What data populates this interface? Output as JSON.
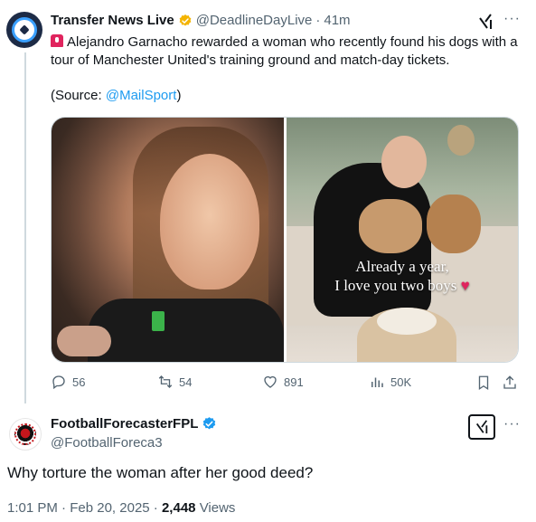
{
  "tweet1": {
    "display_name": "Transfer News Live",
    "handle": "@DeadlineDayLive",
    "separator": "·",
    "time": "41m",
    "text": "Alejandro Garnacho rewarded a woman who recently found his dogs with a tour of Manchester United's training ground and match-day tickets.",
    "source_prefix": "(Source: ",
    "source_link": "@MailSport",
    "source_suffix": ")",
    "image_caption_line1": "Already a year,",
    "image_caption_line2": "I love you two boys",
    "more_label": "···",
    "actions": {
      "replies": "56",
      "reposts": "54",
      "likes": "891",
      "views": "50K"
    },
    "icons": [
      "siren-icon",
      "verified-gold-icon",
      "grok-icon",
      "reply-icon",
      "repost-icon",
      "like-icon",
      "views-icon",
      "bookmark-icon",
      "share-icon"
    ],
    "colors": {
      "link": "#1d9bf0",
      "verified_gold": "#f4b400",
      "secondary_text": "#536471"
    }
  },
  "tweet2": {
    "display_name": "FootballForecasterFPL",
    "handle": "@FootballForeca3",
    "more_label": "···",
    "text": "Why torture the woman after her good deed?",
    "time": "1:01 PM",
    "separator": "·",
    "date": "Feb 20, 2025",
    "views_count": "2,448",
    "views_label": "Views",
    "icons": [
      "verified-blue-icon",
      "grok-icon"
    ],
    "colors": {
      "verified_blue": "#1d9bf0"
    }
  }
}
